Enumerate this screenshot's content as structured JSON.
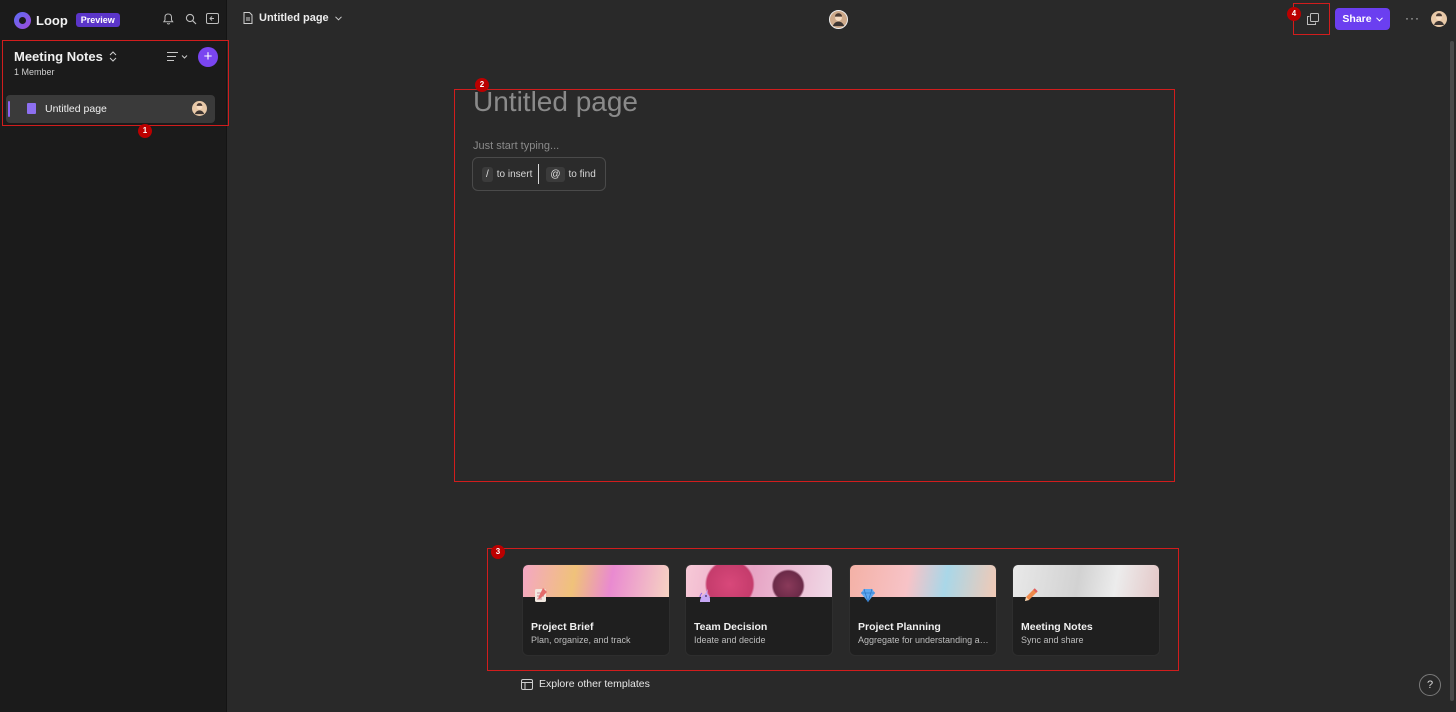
{
  "app": {
    "name": "Loop",
    "badge": "Preview"
  },
  "workspace": {
    "title": "Meeting Notes",
    "subtitle": "1 Member",
    "add_label": "+"
  },
  "sidebar": {
    "items": [
      {
        "label": "Untitled page"
      }
    ]
  },
  "topbar": {
    "doc_title": "Untitled page",
    "share_label": "Share",
    "more_label": "···"
  },
  "editor": {
    "title_placeholder": "Untitled page",
    "hint": "Just start typing...",
    "insert_key": "/",
    "insert_label": "to insert",
    "find_key": "@",
    "find_label": "to find"
  },
  "templates": [
    {
      "title": "Project Brief",
      "subtitle": "Plan, organize, and track",
      "emblem": "notepad-icon"
    },
    {
      "title": "Team Decision",
      "subtitle": "Ideate and decide",
      "emblem": "unicorn-icon"
    },
    {
      "title": "Project Planning",
      "subtitle": "Aggregate for understanding an...",
      "emblem": "gem-icon"
    },
    {
      "title": "Meeting Notes",
      "subtitle": "Sync and share",
      "emblem": "pencil-icon"
    }
  ],
  "explore_label": "Explore other templates",
  "help_label": "?",
  "annotations": [
    "1",
    "2",
    "3",
    "4"
  ],
  "colors": {
    "accent": "#6b3ff0",
    "annotation": "#d11d1d",
    "sidebar_bg": "#1b1b1b",
    "canvas_bg": "#292929"
  }
}
